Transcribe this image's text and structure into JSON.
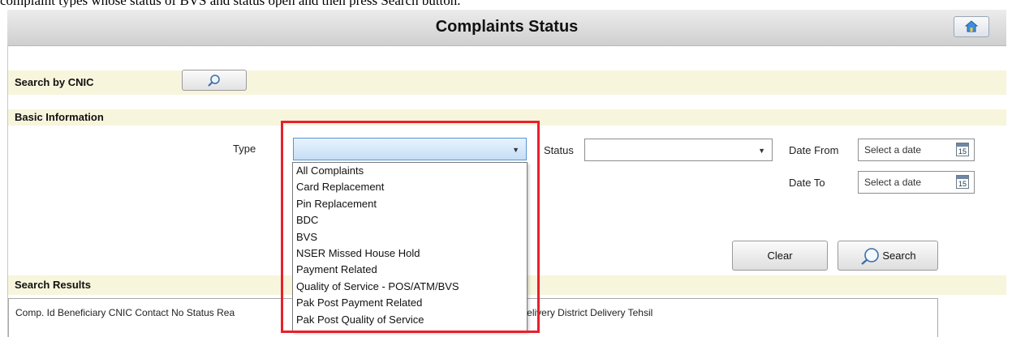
{
  "caption_fragment": "complaint types whose status of BVS and status open and then press Search button.",
  "header": {
    "title": "Complaints Status",
    "home_icon": "home-icon"
  },
  "search_by_cnic": {
    "label": "Search by CNIC",
    "button_icon": "magnifier-icon"
  },
  "basic_information": {
    "label": "Basic Information"
  },
  "filters": {
    "type_label": "Type",
    "type_value": "",
    "status_label": "Status",
    "status_value": "",
    "date_from_label": "Date From",
    "date_from_placeholder": "Select a date",
    "date_to_label": "Date To",
    "date_to_placeholder": "Select a date",
    "calendar_day": "15"
  },
  "type_options": [
    "All Complaints",
    "Card Replacement",
    "Pin Replacement",
    "BDC",
    "BVS",
    "NSER Missed House Hold",
    "Payment Related",
    "Quality of Service - POS/ATM/BVS",
    "Pak Post Payment Related",
    "Pak Post Quality of Service"
  ],
  "actions": {
    "clear_label": "Clear",
    "search_label": "Search"
  },
  "results": {
    "label": "Search Results",
    "columns_left": "Comp. Id Beneficiary CNIC Contact No Status Rea",
    "columns_right": "pdate Delivery District Delivery Tehsil"
  },
  "colors": {
    "band": "#f7f5dc",
    "highlight": "#e8202a",
    "accent": "#5a95d0"
  }
}
